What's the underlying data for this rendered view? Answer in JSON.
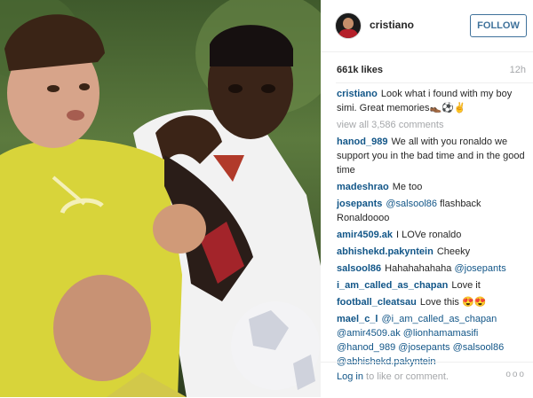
{
  "header": {
    "username": "cristiano",
    "follow_label": "FOLLOW"
  },
  "post": {
    "likes": "661k likes",
    "time": "12h",
    "caption": {
      "user": "cristiano",
      "text": "Look what i found with my boy simi. Great memories👞⚽✌"
    },
    "view_all": "view all 3,586 comments"
  },
  "comments": [
    {
      "user": "hanod_989",
      "text": "We all with you ronaldo we support you in the bad time and in the good time"
    },
    {
      "user": "madeshrao",
      "text": "Me too"
    },
    {
      "user": "josepants",
      "mention": "@salsool86",
      "text": "flashback Ronaldoooo"
    },
    {
      "user": "amir4509.ak",
      "text": "I LOVe ronaldo"
    },
    {
      "user": "abhishekd.pakyntein",
      "text": "Cheeky"
    },
    {
      "user": "salsool86",
      "text": "Hahahahahaha",
      "mention": "@josepants"
    },
    {
      "user": "i_am_called_as_chapan",
      "text": "Love it"
    },
    {
      "user": "football_cleatsau",
      "text": "Love this 😍😍"
    },
    {
      "user": "mael_c_l",
      "mention": "@i_am_called_as_chapan @amir4509.ak @lionhamamasifi @hanod_989 @josepants @salsool86 @abhishekd.pakyntein"
    }
  ],
  "footer": {
    "login_link": "Log in",
    "login_text": "to like or comment.",
    "more": "ooo"
  }
}
